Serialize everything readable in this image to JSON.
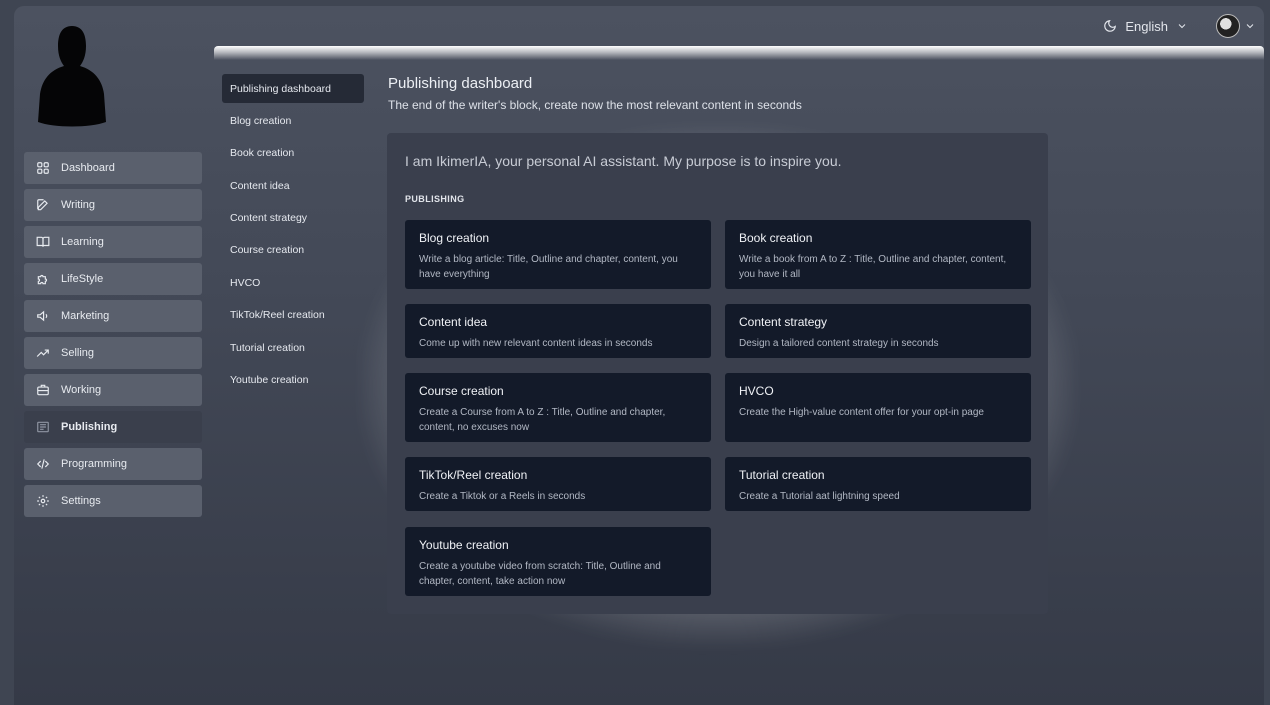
{
  "topbar": {
    "language": "English",
    "theme_icon": "moon-icon",
    "avatar_alt": "user-avatar"
  },
  "nav": [
    {
      "label": "Dashboard",
      "icon": "grid-icon"
    },
    {
      "label": "Writing",
      "icon": "edit-icon"
    },
    {
      "label": "Learning",
      "icon": "book-icon"
    },
    {
      "label": "LifeStyle",
      "icon": "puzzle-icon"
    },
    {
      "label": "Marketing",
      "icon": "megaphone-icon"
    },
    {
      "label": "Selling",
      "icon": "trend-icon"
    },
    {
      "label": "Working",
      "icon": "briefcase-icon"
    },
    {
      "label": "Publishing",
      "icon": "newspaper-icon"
    },
    {
      "label": "Programming",
      "icon": "code-icon"
    },
    {
      "label": "Settings",
      "icon": "gear-icon"
    }
  ],
  "subnav": [
    "Publishing dashboard",
    "Blog creation",
    "Book creation",
    "Content idea",
    "Content strategy",
    "Course creation",
    "HVCO",
    "TikTok/Reel creation",
    "Tutorial creation",
    "Youtube creation"
  ],
  "header": {
    "title": "Publishing dashboard",
    "subtitle": "The end of the writer's block, create now the most relevant content in seconds"
  },
  "panel": {
    "intro": "I am IkimerIA, your personal AI assistant. My purpose is to inspire you.",
    "section": "PUBLISHING",
    "cards": [
      {
        "title": "Blog creation",
        "desc": "Write a blog article: Title, Outline and chapter, content, you have everything"
      },
      {
        "title": "Book creation",
        "desc": "Write a book from A to Z : Title, Outline and chapter, content, you have it all"
      },
      {
        "title": "Content idea",
        "desc": "Come up with new relevant content ideas in seconds"
      },
      {
        "title": "Content strategy",
        "desc": "Design a tailored content strategy in seconds"
      },
      {
        "title": "Course creation",
        "desc": "Create a Course from A to Z : Title, Outline and chapter, content, no excuses now"
      },
      {
        "title": "HVCO",
        "desc": "Create the High-value content offer for your opt-in page"
      },
      {
        "title": "TikTok/Reel creation",
        "desc": "Create a Tiktok or a Reels in seconds"
      },
      {
        "title": "Tutorial creation",
        "desc": "Create a Tutorial aat lightning speed"
      },
      {
        "title": "Youtube creation",
        "desc": "Create a youtube video from scratch: Title, Outline and chapter, content, take action now"
      }
    ]
  }
}
